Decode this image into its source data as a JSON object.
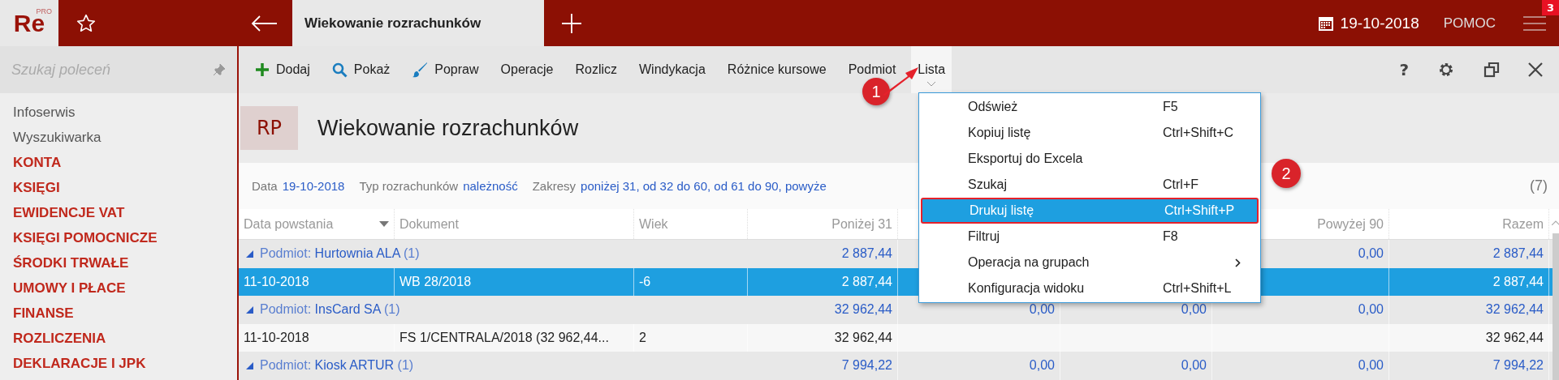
{
  "app": {
    "logo": "Re",
    "logo_edition": "PRO"
  },
  "tab": {
    "title": "Wiekowanie rozrachunków"
  },
  "top_bar": {
    "date": "19-10-2018",
    "help": "POMOC",
    "notifications": "3"
  },
  "sidebar": {
    "search": {
      "placeholder": "Szukaj poleceń"
    },
    "items": [
      {
        "label": "Infoserwis",
        "kind": "link"
      },
      {
        "label": "Wyszukiwarka",
        "kind": "link"
      },
      {
        "label": "KONTA",
        "kind": "section"
      },
      {
        "label": "KSIĘGI",
        "kind": "section"
      },
      {
        "label": "EWIDENCJE VAT",
        "kind": "section"
      },
      {
        "label": "KSIĘGI POMOCNICZE",
        "kind": "section"
      },
      {
        "label": "ŚRODKI TRWAŁE",
        "kind": "section"
      },
      {
        "label": "UMOWY I PŁACE",
        "kind": "section"
      },
      {
        "label": "FINANSE",
        "kind": "section"
      },
      {
        "label": "ROZLICZENIA",
        "kind": "section"
      },
      {
        "label": "DEKLARACJE I JPK",
        "kind": "section"
      }
    ]
  },
  "toolbar": {
    "items": [
      {
        "label": "Dodaj",
        "kind": "add",
        "selected": false
      },
      {
        "label": "Pokaż",
        "kind": "show",
        "selected": false
      },
      {
        "label": "Popraw",
        "kind": "edit",
        "selected": false
      },
      {
        "label": "Operacje",
        "kind": "text",
        "selected": false
      },
      {
        "label": "Rozlicz",
        "kind": "text",
        "selected": false
      },
      {
        "label": "Windykacja",
        "kind": "text",
        "selected": false
      },
      {
        "label": "Różnice kursowe",
        "kind": "text",
        "selected": false
      },
      {
        "label": "Podmiot",
        "kind": "text",
        "selected": false
      },
      {
        "label": "Lista",
        "kind": "text",
        "selected": true
      }
    ],
    "help": "?"
  },
  "header": {
    "badge": "RP",
    "title": "Wiekowanie rozrachunków"
  },
  "filters": [
    {
      "label": "Data",
      "value": "19-10-2018"
    },
    {
      "label": "Typ rozrachunków",
      "value": "należność"
    },
    {
      "label": "Zakresy",
      "value": "poniżej 31, od 32 do 60, od 61 do 90, powyże"
    }
  ],
  "count": "(7)",
  "table": {
    "columns": [
      {
        "label": "Data powstania",
        "sorted": true
      },
      {
        "label": "Dokument",
        "sorted": false
      },
      {
        "label": "Wiek",
        "sorted": false
      },
      {
        "label": "Poniżej 31",
        "sorted": false
      },
      {},
      {},
      {
        "label": "Powyżej 90",
        "sorted": false
      },
      {
        "label": "Razem",
        "sorted": false
      }
    ],
    "rows": [
      {
        "kind": "group",
        "label": "Podmiot:",
        "name": "Hurtownia ALA",
        "count": "(1)",
        "expanded": true,
        "selected": false,
        "cells": [
          null,
          null,
          null,
          "2 887,44",
          null,
          null,
          "0,00",
          "2 887,44"
        ]
      },
      {
        "kind": "item",
        "selected": true,
        "cells": [
          "11-10-2018",
          "WB 28/2018",
          "-6",
          "2 887,44",
          null,
          null,
          null,
          "2 887,44"
        ]
      },
      {
        "kind": "group",
        "label": "Podmiot:",
        "name": "InsCard SA",
        "count": "(1)",
        "expanded": true,
        "selected": false,
        "cells": [
          null,
          null,
          null,
          "32 962,44",
          "0,00",
          "0,00",
          "0,00",
          "32 962,44"
        ]
      },
      {
        "kind": "item",
        "selected": false,
        "cells": [
          "11-10-2018",
          "FS 1/CENTRALA/2018 (32 962,44...",
          "2",
          "32 962,44",
          null,
          null,
          null,
          "32 962,44"
        ]
      },
      {
        "kind": "group",
        "label": "Podmiot:",
        "name": "Kiosk ARTUR",
        "count": "(1)",
        "expanded": true,
        "selected": false,
        "cells": [
          null,
          null,
          null,
          "7 994,22",
          "0,00",
          "0,00",
          "0,00",
          "7 994,22"
        ]
      }
    ]
  },
  "menu": {
    "items": [
      {
        "label": "Odśwież",
        "shortcut": "F5",
        "selected": false,
        "annotated": false,
        "submenu": false
      },
      {
        "label": "Kopiuj listę",
        "shortcut": "Ctrl+Shift+C",
        "selected": false,
        "annotated": false,
        "submenu": false
      },
      {
        "label": "Eksportuj do Excela",
        "selected": false,
        "annotated": false,
        "submenu": false
      },
      {
        "label": "Szukaj",
        "shortcut": "Ctrl+F",
        "selected": false,
        "annotated": false,
        "submenu": false
      },
      {
        "label": "Drukuj listę",
        "shortcut": "Ctrl+Shift+P",
        "selected": true,
        "annotated": true,
        "submenu": false
      },
      {
        "label": "Filtruj",
        "shortcut": "F8",
        "selected": false,
        "annotated": false,
        "submenu": false
      },
      {
        "label": "Operacja na grupach",
        "selected": false,
        "annotated": false,
        "submenu": true
      },
      {
        "label": "Konfiguracja widoku",
        "shortcut": "Ctrl+Shift+L",
        "selected": false,
        "annotated": false,
        "submenu": false
      }
    ]
  },
  "annotations": [
    {
      "number": "1",
      "arrow": true
    },
    {
      "number": "2"
    }
  ]
}
